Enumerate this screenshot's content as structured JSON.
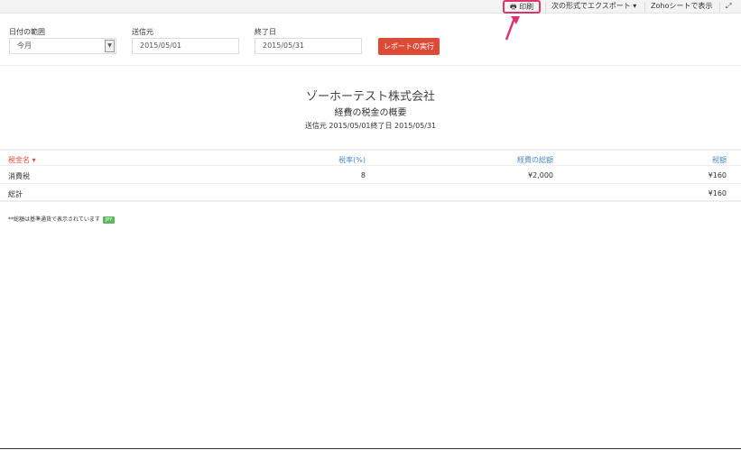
{
  "toolbar": {
    "print": "印刷",
    "export": "次の形式でエクスポート ▾",
    "zoho_sheet": "Zohoシートで表示"
  },
  "filters": {
    "date_range_label": "日付の範囲",
    "date_range_value": "今月",
    "from_label": "送信元",
    "from_value": "2015/05/01",
    "to_label": "終了日",
    "to_value": "2015/05/31",
    "run_button": "レポートの実行"
  },
  "report": {
    "company": "ゾーホーテスト株式会社",
    "title": "経費の税金の概要",
    "period": "送信元 2015/05/01終了日 2015/05/31"
  },
  "table": {
    "headers": [
      "税金名 ▾",
      "税率(%)",
      "経費の総額",
      "税額"
    ],
    "rows": [
      {
        "name": "消費税",
        "rate": "8",
        "total": "¥2,000",
        "tax": "¥160"
      },
      {
        "name": "総計",
        "rate": "",
        "total": "",
        "tax": "¥160"
      }
    ]
  },
  "footnote": {
    "text": "**総額は基準通貨で表示されています",
    "currency": "JPY"
  },
  "colors": {
    "accent": "#dc4a38",
    "highlight": "#e0336a",
    "header_link": "#4a8ac6"
  }
}
